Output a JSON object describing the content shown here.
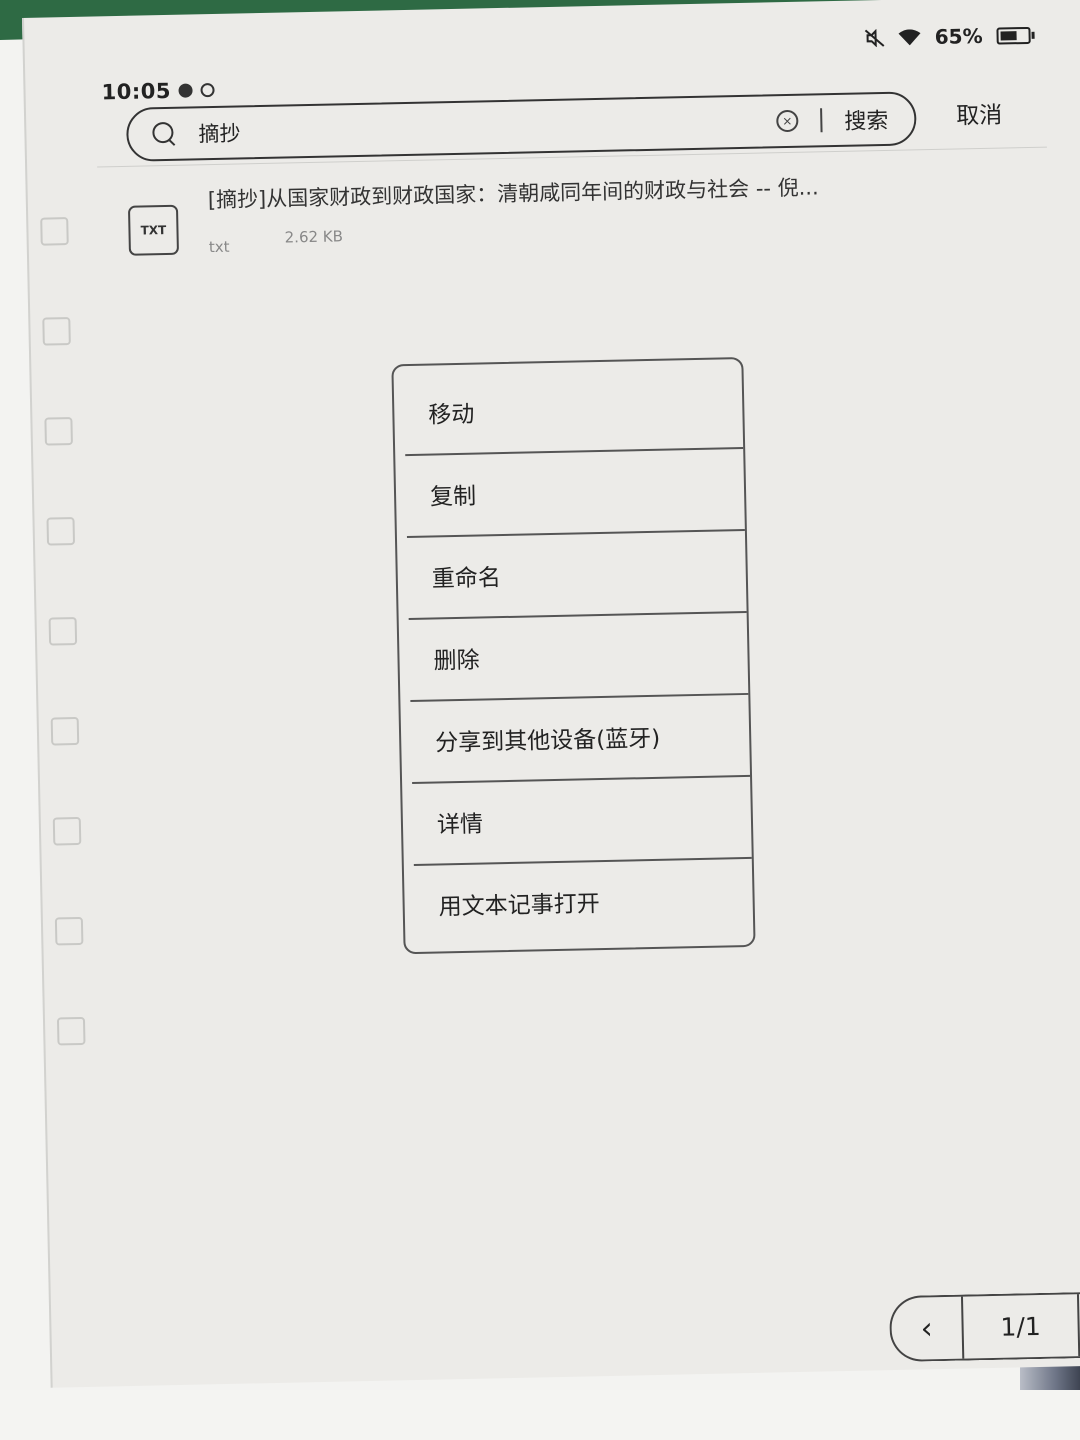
{
  "status_bar": {
    "time": "10:05",
    "battery_percent": "65%",
    "icons": [
      "check-circle-icon",
      "sync-icon",
      "mute-icon",
      "wifi-icon",
      "battery-icon"
    ]
  },
  "search": {
    "query": "摘抄",
    "search_label": "搜索",
    "cancel_label": "取消",
    "clear_icon": "clear-icon"
  },
  "results": [
    {
      "type_badge": "TXT",
      "title": "[摘抄]从国家财政到财政国家：清朝咸同年间的财政与社会 -- 倪...",
      "extension": "txt",
      "size": "2.62 KB"
    }
  ],
  "context_menu": {
    "items": [
      "移动",
      "复制",
      "重命名",
      "删除",
      "分享到其他设备(蓝牙)",
      "详情",
      "用文本记事打开"
    ]
  },
  "pager": {
    "label": "1/1",
    "prev_icon": "chevron-left-icon",
    "next_icon": "chevron-right-icon"
  }
}
